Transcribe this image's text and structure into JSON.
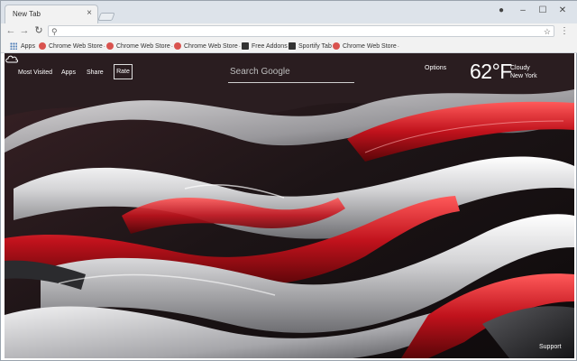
{
  "browser": {
    "tab_title": "New Tab",
    "tab_close": "×",
    "window_controls": {
      "account": "●",
      "minimize": "–",
      "maximize": "☐",
      "close": "✕"
    },
    "nav": {
      "back": "←",
      "forward": "→",
      "reload": "↻"
    },
    "omnibox": {
      "value": "",
      "search_icon": "⚲",
      "star_icon": "☆"
    },
    "menu_icon": "⋮"
  },
  "bookmarks": [
    {
      "label": "Apps",
      "icon": "apps-grid-icon",
      "color": "#4a7ab5"
    },
    {
      "label": "Chrome Web Store",
      "icon": "web-store-icon",
      "color": "#d9534f",
      "caret": "-"
    },
    {
      "label": "Chrome Web Store",
      "icon": "web-store-icon",
      "color": "#d9534f",
      "caret": "-"
    },
    {
      "label": "Chrome Web Store",
      "icon": "web-store-icon",
      "color": "#d9534f",
      "caret": "-"
    },
    {
      "label": "Free Addons",
      "icon": "addon-icon",
      "color": "#333333"
    },
    {
      "label": "Sportify Tab",
      "icon": "addon-icon",
      "color": "#333333"
    },
    {
      "label": "Chrome Web Store",
      "icon": "web-store-icon",
      "color": "#d9534f",
      "caret": "-"
    }
  ],
  "ntp": {
    "links": [
      "Most Visited",
      "Apps",
      "Share"
    ],
    "rate_label": "Rate",
    "search_placeholder": "Search Google",
    "options_label": "Options",
    "weather": {
      "temperature": "62°F",
      "condition": "Cloudy",
      "location": "New York",
      "icon": "cloud-icon"
    },
    "support_label": "Support"
  },
  "colors": {
    "accent_red": "#c0121c",
    "titlebar": "#dde3ea",
    "toolbar": "#f2f2f2"
  }
}
